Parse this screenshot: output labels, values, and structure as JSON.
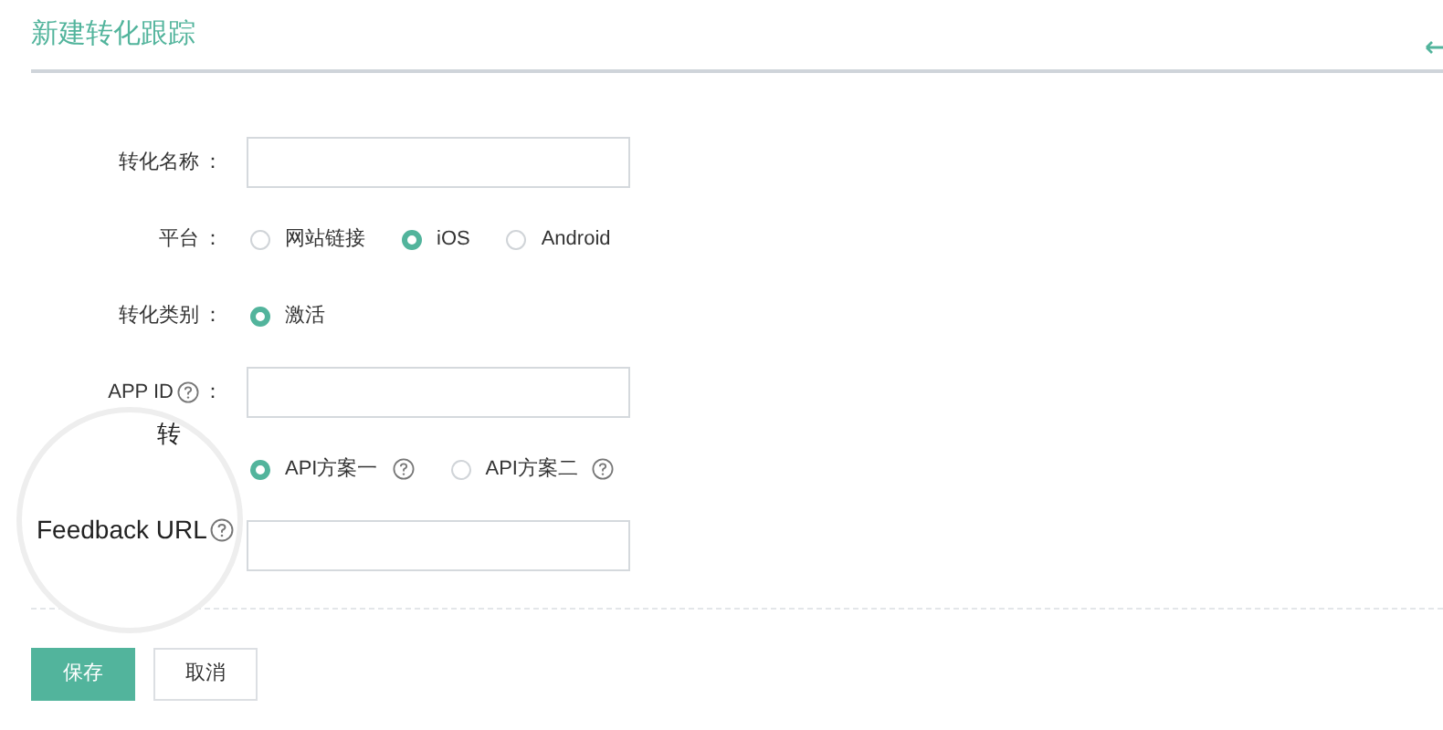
{
  "title": "新建转化跟踪",
  "rows": [
    {
      "kind": "text",
      "label": "转化名称",
      "colon": "："
    },
    {
      "kind": "radio",
      "label": "平台",
      "colon": "：",
      "options": [
        {
          "label": "网站链接",
          "selected": false
        },
        {
          "label": "iOS",
          "selected": true
        },
        {
          "label": "Android",
          "selected": false
        }
      ]
    },
    {
      "kind": "radio",
      "label": "转化类别",
      "colon": "：",
      "options": [
        {
          "label": "激活",
          "selected": true
        }
      ]
    },
    {
      "kind": "text",
      "label": "APP ID",
      "help": true,
      "colon": "："
    },
    {
      "kind": "radio",
      "options": [
        {
          "label": "API方案一",
          "help": true,
          "selected": true
        },
        {
          "label": "API方案二",
          "help": true,
          "selected": false
        }
      ]
    },
    {
      "kind": "text"
    }
  ],
  "buttons": [
    {
      "label": "保存",
      "kind": "primary"
    },
    {
      "label": "取消",
      "kind": "secondary"
    }
  ],
  "magnifier": {
    "partial_label": "转",
    "label": "Feedback URL",
    "help": true
  }
}
